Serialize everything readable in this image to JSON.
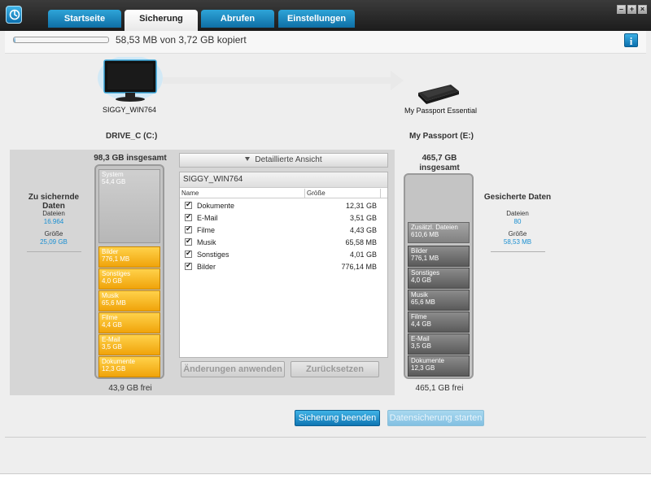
{
  "window": {
    "tabs": [
      {
        "label": "Startseite",
        "active": false
      },
      {
        "label": "Sicherung",
        "active": true
      },
      {
        "label": "Abrufen",
        "active": false
      },
      {
        "label": "Einstellungen",
        "active": false
      }
    ],
    "controls": [
      "minimize",
      "maximize",
      "close"
    ]
  },
  "status": {
    "copy_text": "58,53 MB von 3,72 GB kopiert",
    "progress_fraction": 0.02
  },
  "source": {
    "computer_name": "SIGGY_WIN764",
    "drive_title": "DRIVE_C (C:)",
    "total": "98,3 GB insgesamt",
    "free": "43,9 GB frei",
    "stats": {
      "heading": "Zu sichernde Daten",
      "files_label": "Dateien",
      "files_value": "16.964",
      "size_label": "Größe",
      "size_value": "25,09 GB"
    },
    "segments": [
      {
        "name": "System",
        "size": "54,4 GB"
      },
      {
        "name": "Bilder",
        "size": "776,1 MB"
      },
      {
        "name": "Sonstiges",
        "size": "4,0 GB"
      },
      {
        "name": "Musik",
        "size": "65,6 MB"
      },
      {
        "name": "Filme",
        "size": "4,4 GB"
      },
      {
        "name": "E-Mail",
        "size": "3,5 GB"
      },
      {
        "name": "Dokumente",
        "size": "12,3 GB"
      }
    ]
  },
  "target": {
    "device_name": "My Passport Essential",
    "drive_title": "My Passport (E:)",
    "total": "465,7 GB insgesamt",
    "free": "465,1 GB frei",
    "stats": {
      "heading": "Gesicherte Daten",
      "files_label": "Dateien",
      "files_value": "80",
      "size_label": "Größe",
      "size_value": "58,53 MB"
    },
    "segments": [
      {
        "name": "Zusätzl. Dateien",
        "size": "610,6 MB"
      },
      {
        "name": "Bilder",
        "size": "776,1 MB"
      },
      {
        "name": "Sonstiges",
        "size": "4,0 GB"
      },
      {
        "name": "Musik",
        "size": "65,6 MB"
      },
      {
        "name": "Filme",
        "size": "4,4 GB"
      },
      {
        "name": "E-Mail",
        "size": "3,5 GB"
      },
      {
        "name": "Dokumente",
        "size": "12,3 GB"
      }
    ]
  },
  "detail": {
    "toggle_label": "Detaillierte Ansicht",
    "header": "SIGGY_WIN764",
    "col_name": "Name",
    "col_size": "Größe",
    "rows": [
      {
        "name": "Dokumente",
        "size": "12,31 GB",
        "checked": true
      },
      {
        "name": "E-Mail",
        "size": "3,51 GB",
        "checked": true
      },
      {
        "name": "Filme",
        "size": "4,43 GB",
        "checked": true
      },
      {
        "name": "Musik",
        "size": "65,58 MB",
        "checked": true
      },
      {
        "name": "Sonstiges",
        "size": "4,01 GB",
        "checked": true
      },
      {
        "name": "Bilder",
        "size": "776,14 MB",
        "checked": true
      }
    ],
    "apply_label": "Änderungen anwenden",
    "reset_label": "Zurücksetzen"
  },
  "actions": {
    "stop_label": "Sicherung beenden",
    "start_label": "Datensicherung starten"
  }
}
